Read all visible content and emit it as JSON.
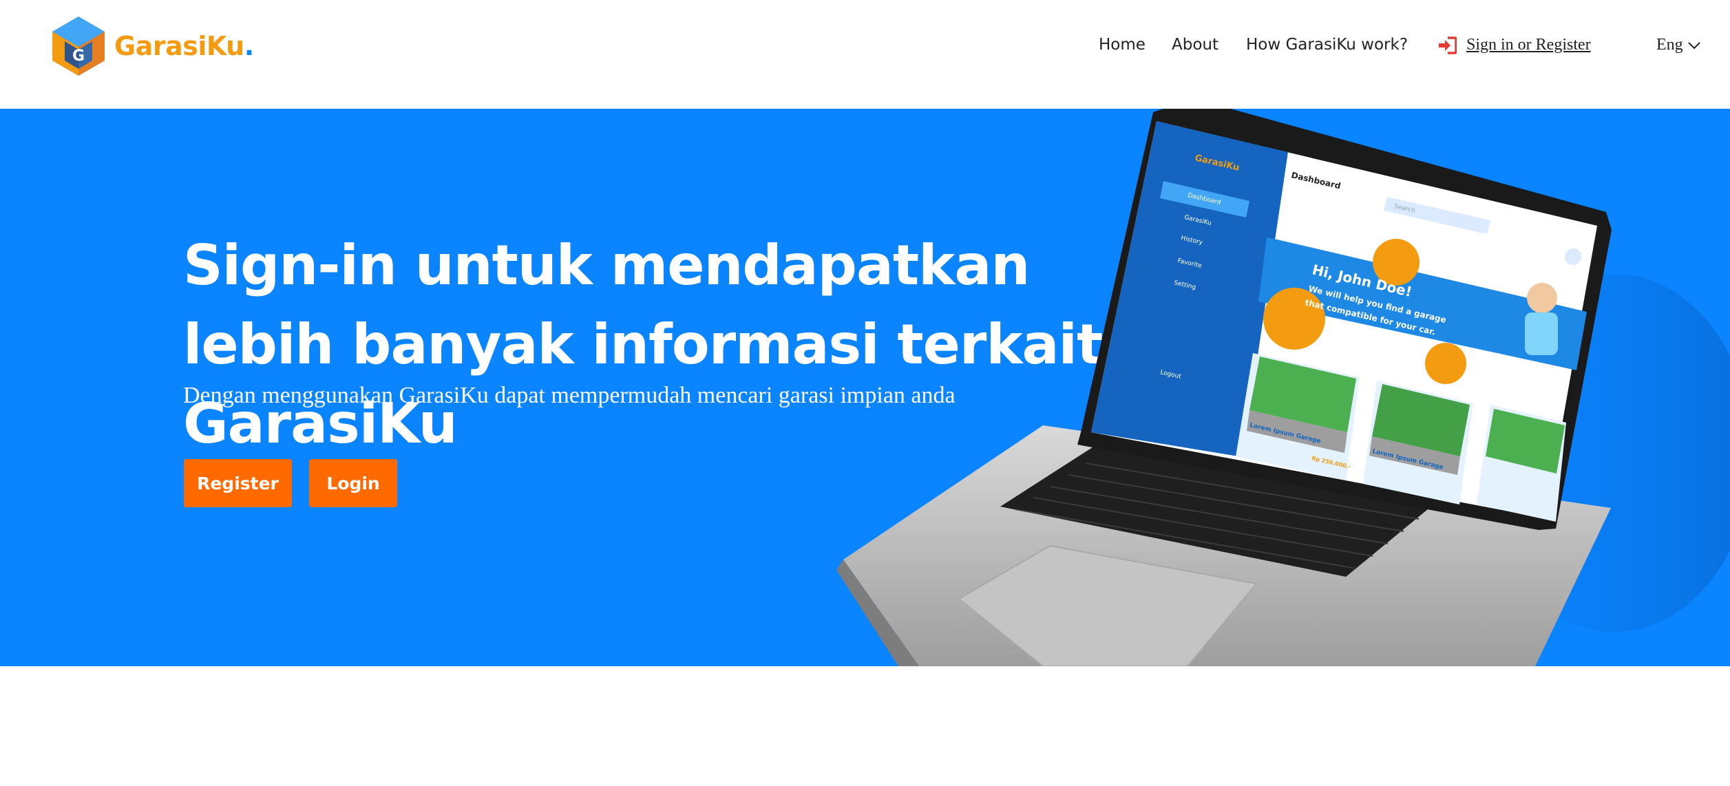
{
  "brand": {
    "name": "GarasiKu",
    "dot": ".",
    "colors": {
      "orange": "#f39c12",
      "blue": "#0a84ff"
    }
  },
  "nav": {
    "home": "Home",
    "about": "About",
    "how": "How GarasiKu work?",
    "signin": "Sign in or Register",
    "language": "Eng"
  },
  "hero": {
    "title": "Sign-in untuk mendapatkan lebih banyak informasi terkait GarasiKu",
    "subtitle": "Dengan menggunakan GarasiKu dapat mempermudah mencari garasi impian anda",
    "register_label": "Register",
    "login_label": "Login",
    "background": "#0a84ff",
    "button_color": "#ff6a00"
  },
  "mockup": {
    "brand": "GarasiKu",
    "sidebar": [
      "Dashboard",
      "GarasiKu",
      "History",
      "Favorite",
      "Setting"
    ],
    "logout": "Logout",
    "page_title": "Dashboard",
    "search_placeholder": "Search",
    "greeting": "Hi, John Doe!",
    "greeting_sub_1": "We will help you find a garage",
    "greeting_sub_2": "that compatible for your car.",
    "card_title": "Lorem Ipsum Garage",
    "card_price": "Rp 250.000,-"
  }
}
